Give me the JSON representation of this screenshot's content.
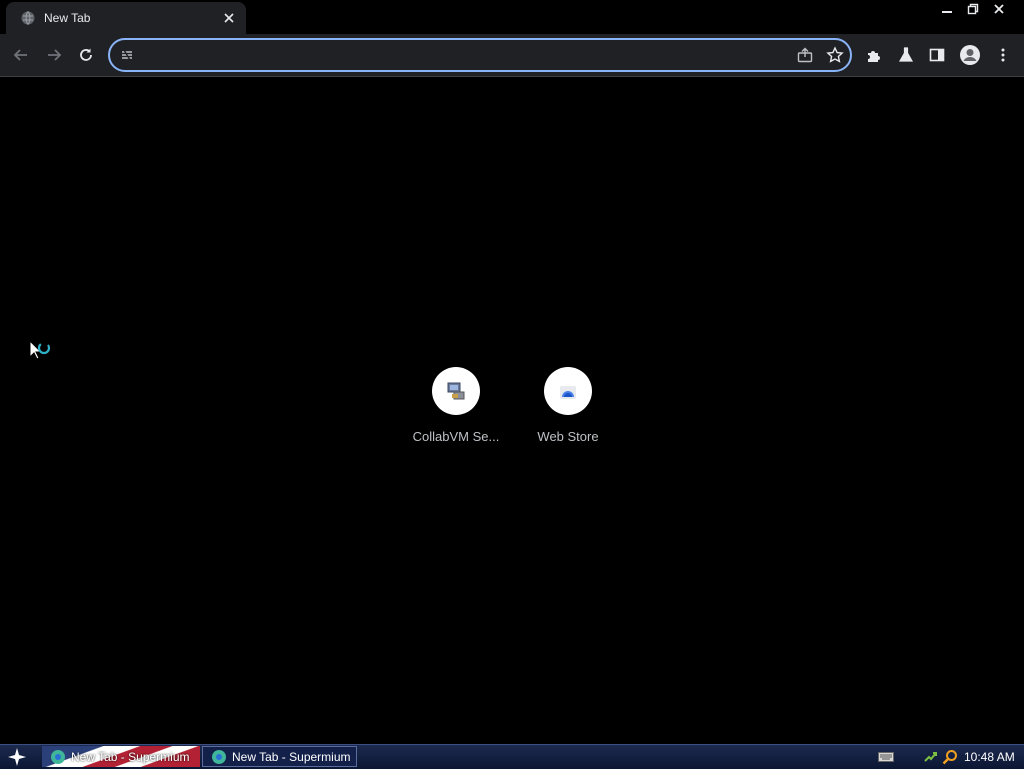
{
  "tab": {
    "title": "New Tab",
    "favicon": "globe-icon",
    "close_icon": "close-icon"
  },
  "window_controls": [
    "minimize-icon",
    "restore-icon",
    "close-icon"
  ],
  "toolbar": {
    "back_icon": "back-arrow-icon",
    "forward_icon": "forward-arrow-icon",
    "reload_icon": "reload-icon",
    "extensions_icon": "puzzle-icon",
    "labs_icon": "flask-icon",
    "side_panel_icon": "side-panel-icon",
    "profile_icon": "profile-avatar-icon",
    "menu_icon": "kebab-menu-icon"
  },
  "omnibox": {
    "value": "",
    "placeholder": "",
    "share_icon": "share-icon",
    "bookmark_icon": "star-icon"
  },
  "shortcuts": [
    {
      "label": "CollabVM Se...",
      "icon": "collabvm-computer-icon"
    },
    {
      "label": "Web Store",
      "icon": "web-store-icon"
    }
  ],
  "taskbar": {
    "start_icon": "start-star-icon",
    "buttons": [
      {
        "label": "New Tab - Supermium"
      },
      {
        "label": "New Tab - Supermium"
      }
    ],
    "clock": "10:48 AM"
  },
  "colors": {
    "accent": "#8ab4f8",
    "toolbar_bg": "#202124",
    "page_bg": "#000000",
    "taskbar_bg": "#13204a"
  }
}
